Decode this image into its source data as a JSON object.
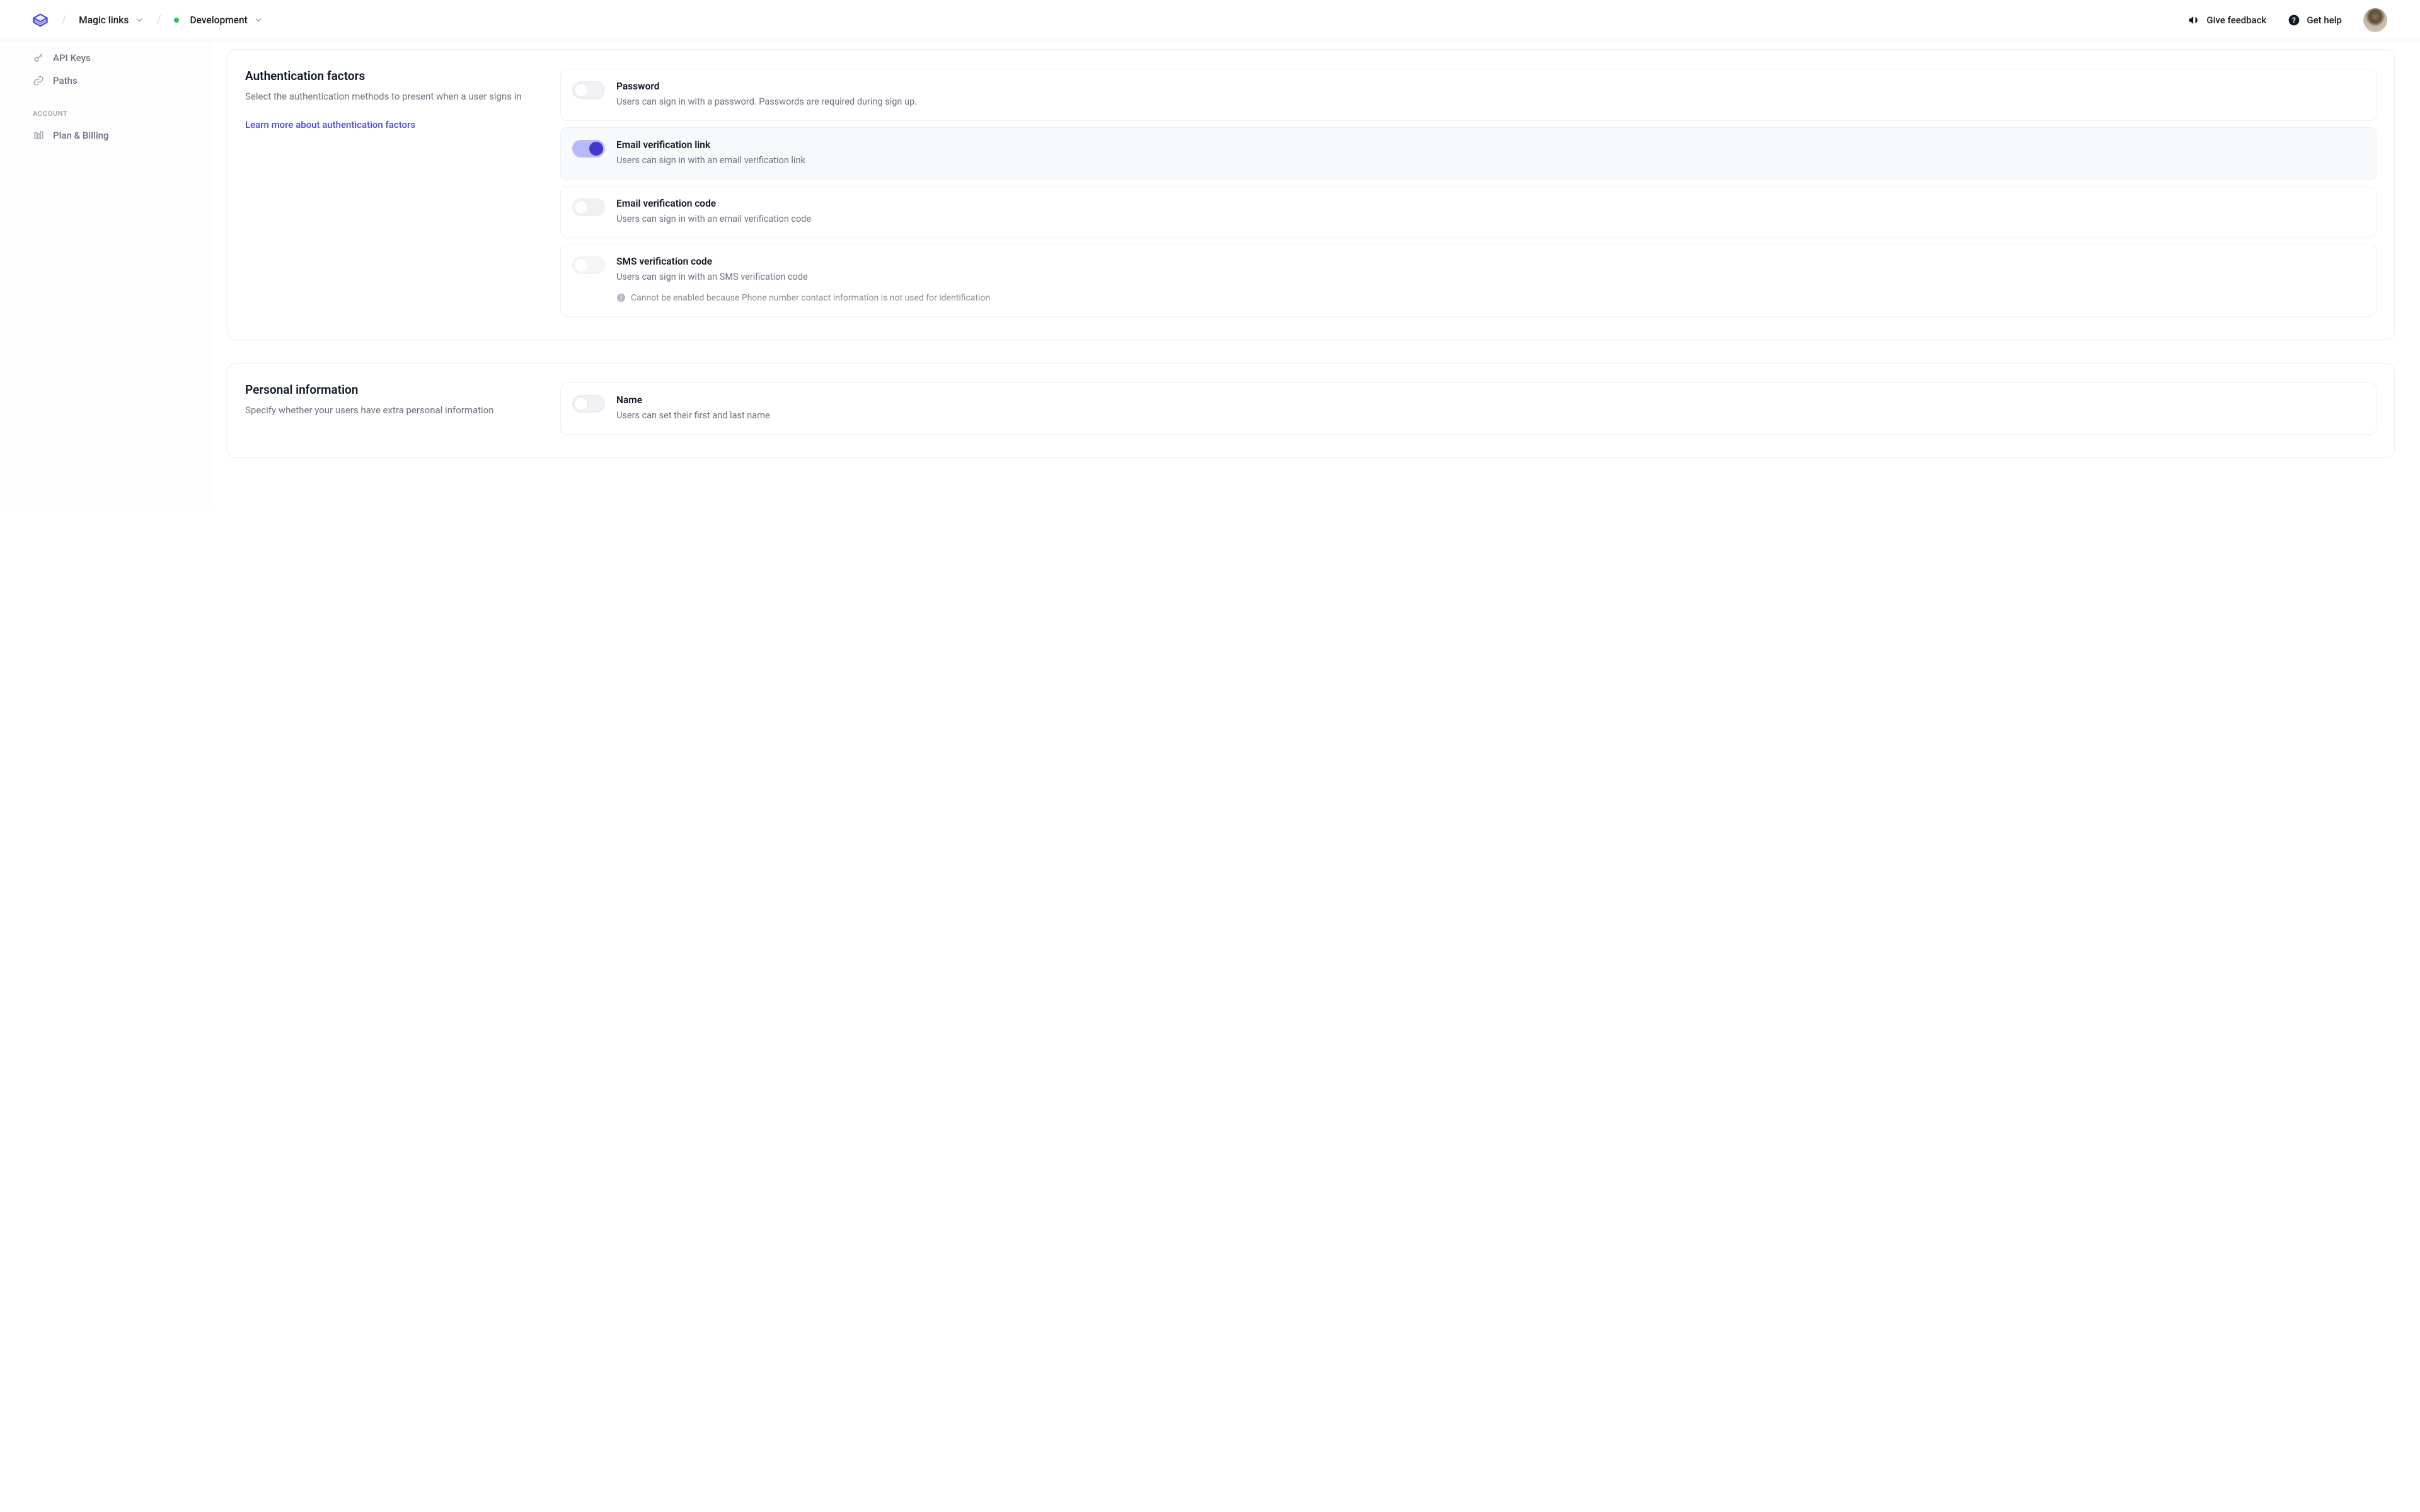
{
  "header": {
    "breadcrumbs": {
      "app": "Magic links",
      "env": "Development"
    },
    "actions": {
      "feedback": "Give feedback",
      "help": "Get help"
    }
  },
  "sidebar": {
    "items": [
      {
        "label": "API Keys"
      },
      {
        "label": "Paths"
      }
    ],
    "section_label": "ACCOUNT",
    "account_items": [
      {
        "label": "Plan & Billing"
      }
    ]
  },
  "sections": {
    "auth_factors": {
      "title": "Authentication factors",
      "desc": "Select the authentication methods to present when a user signs in",
      "link": "Learn more about authentication factors",
      "options": [
        {
          "title": "Password",
          "desc": "Users can sign in with a password. Passwords are required during sign up.",
          "enabled": false,
          "active": false
        },
        {
          "title": "Email verification link",
          "desc": "Users can sign in with an email verification link",
          "enabled": true,
          "active": true
        },
        {
          "title": "Email verification code",
          "desc": "Users can sign in with an email verification code",
          "enabled": false,
          "active": false
        },
        {
          "title": "SMS verification code",
          "desc": "Users can sign in with an SMS verification code",
          "enabled": false,
          "active": false,
          "disabled": true,
          "warning": "Cannot be enabled because Phone number contact information is not used for identification"
        }
      ]
    },
    "personal_info": {
      "title": "Personal information",
      "desc": "Specify whether your users have extra personal information",
      "options": [
        {
          "title": "Name",
          "desc": "Users can set their first and last name",
          "enabled": false
        }
      ]
    }
  }
}
